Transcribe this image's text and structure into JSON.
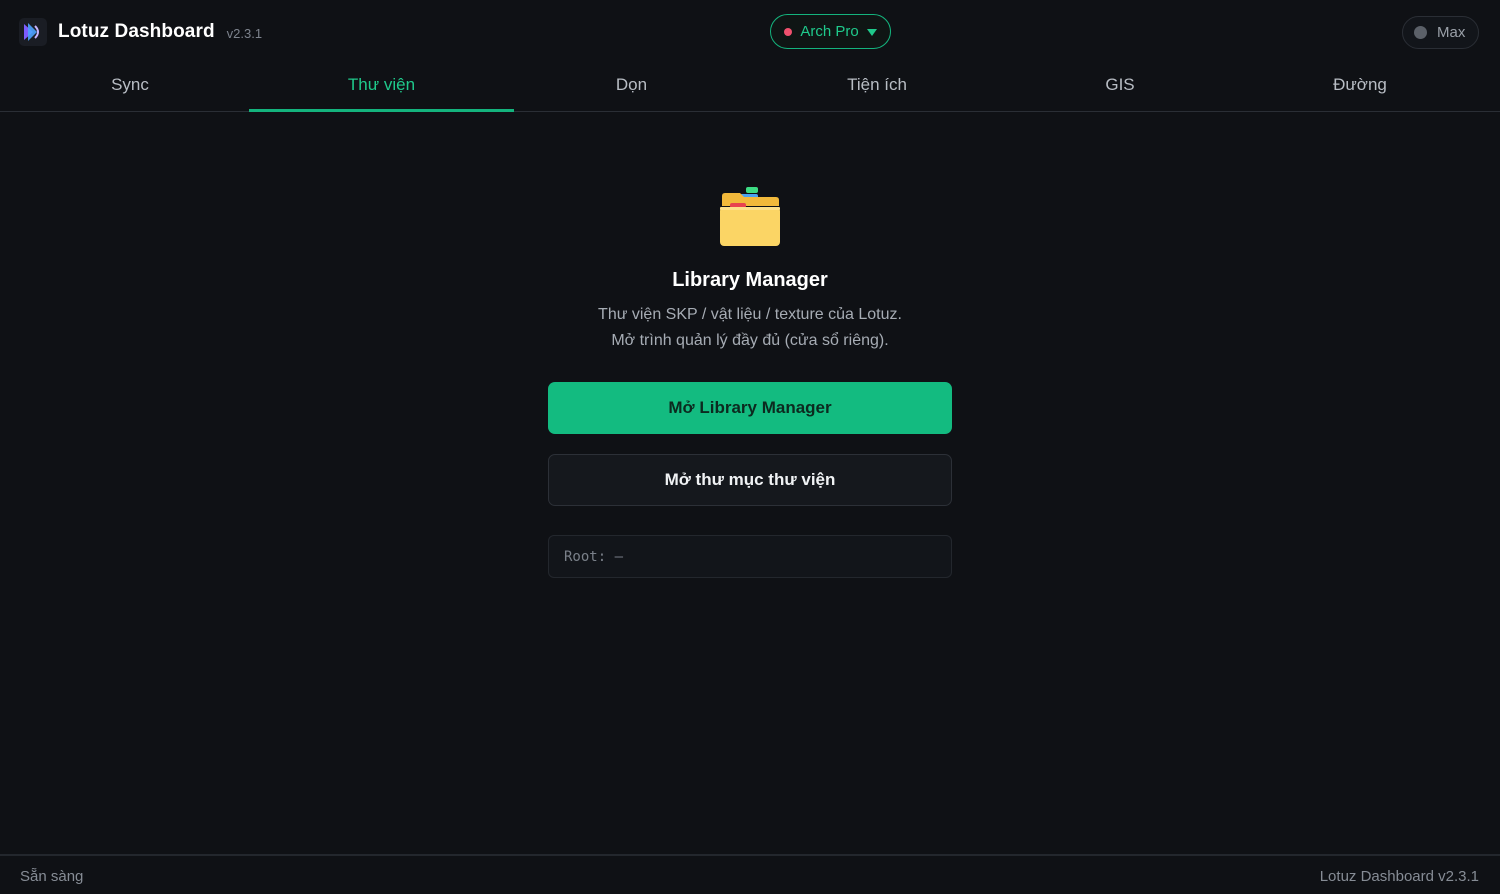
{
  "header": {
    "app_title": "Lotuz Dashboard",
    "version": "v2.3.1",
    "logo_icon": "lotus-logo-icon",
    "profile": {
      "label": "Arch Pro",
      "dot_color": "#f0506e",
      "accent": "#1fc98b"
    },
    "mode": {
      "label": "Max"
    }
  },
  "tabs": [
    {
      "label": "Sync",
      "active": false
    },
    {
      "label": "Thư viện",
      "active": true
    },
    {
      "label": "Dọn",
      "active": false
    },
    {
      "label": "Tiện ích",
      "active": false
    },
    {
      "label": "GIS",
      "active": false
    },
    {
      "label": "Đường",
      "active": false
    }
  ],
  "panel": {
    "icon": "folder-icon",
    "title": "Library Manager",
    "description_line1": "Thư viện SKP / vật liệu / texture của Lotuz.",
    "description_line2": "Mở trình quản lý đầy đủ (cửa sổ riêng).",
    "primary_button": "Mở Library Manager",
    "secondary_button": "Mở thư mục thư viện",
    "root_text": "Root: —"
  },
  "status_bar": {
    "left": "Sẵn sàng",
    "right": "Lotuz Dashboard v2.3.1"
  },
  "colors": {
    "background": "#0f1115",
    "accent": "#13bb80",
    "border": "#2a2e35"
  }
}
